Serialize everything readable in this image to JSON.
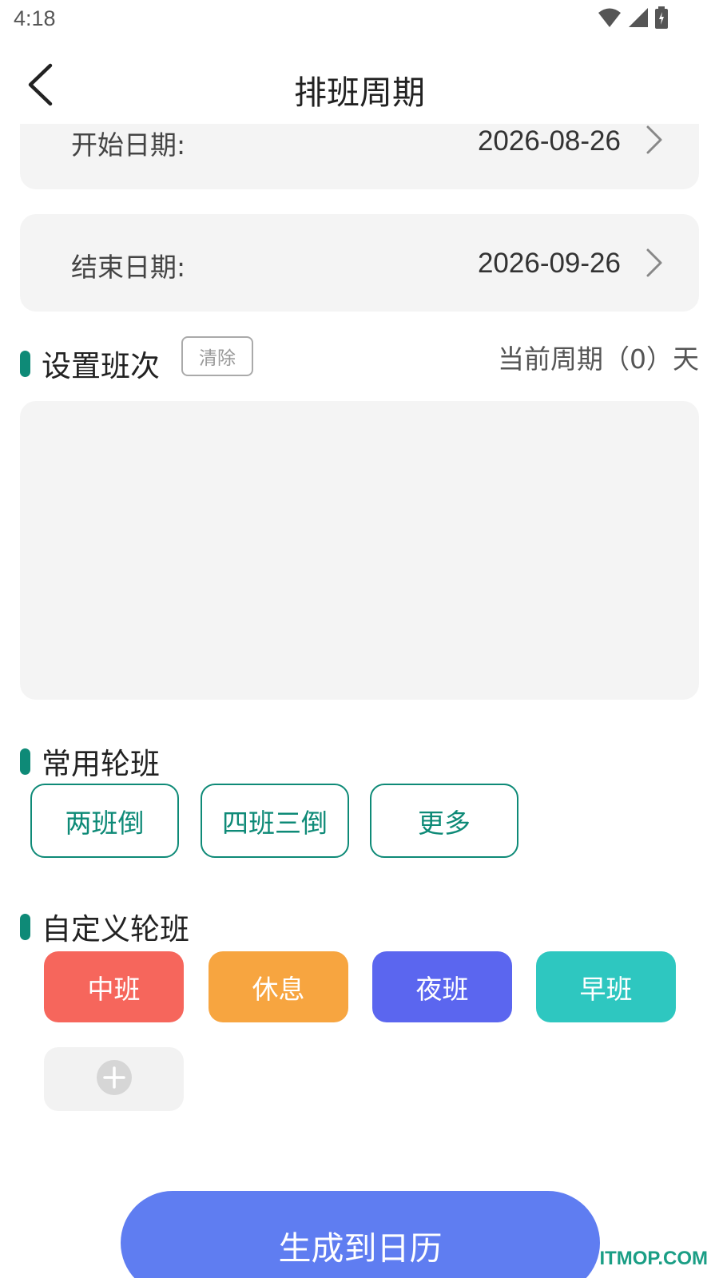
{
  "status_bar": {
    "time": "4:18",
    "icons": [
      "wifi-icon",
      "signal-icon",
      "battery-icon"
    ]
  },
  "nav": {
    "title": "排班周期",
    "back_icon": "chevron-left-icon"
  },
  "start_date": {
    "label": "开始日期:",
    "value": "2026-08-26"
  },
  "end_date": {
    "label": "结束日期:",
    "value": "2026-09-26"
  },
  "shift_setup": {
    "title": "设置班次",
    "clear_label": "清除",
    "cycle_text": "当前周期（0）天"
  },
  "common_rotation": {
    "title": "常用轮班",
    "options": [
      "两班倒",
      "四班三倒",
      "更多"
    ]
  },
  "custom_rotation": {
    "title": "自定义轮班",
    "shifts": [
      {
        "label": "中班",
        "color": "#f6665c"
      },
      {
        "label": "休息",
        "color": "#f7a540"
      },
      {
        "label": "夜班",
        "color": "#5b66ef"
      },
      {
        "label": "早班",
        "color": "#2ec7c0"
      }
    ],
    "add_icon": "plus-circle-icon"
  },
  "generate_label": "生成到日历",
  "watermark": "ITMOP.COM",
  "colors": {
    "accent": "#0e8a77",
    "primary_button": "#5f7df1",
    "card_bg": "#f4f4f4"
  }
}
